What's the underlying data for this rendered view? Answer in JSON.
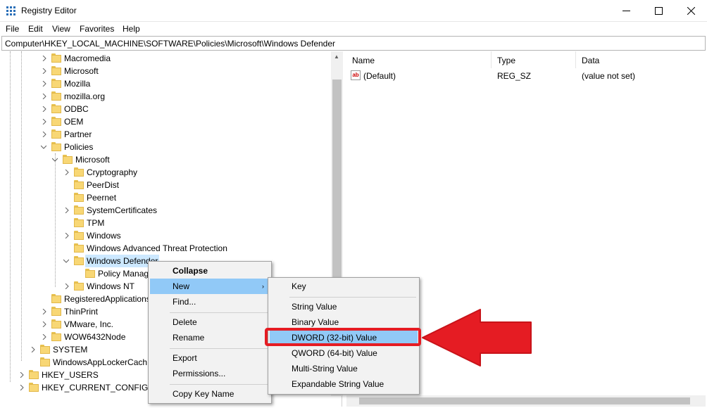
{
  "window": {
    "title": "Registry Editor",
    "accent_color": "#e51c23",
    "highlight_color": "#91c9f7",
    "selection_color": "#cce8ff"
  },
  "menubar": [
    "File",
    "Edit",
    "View",
    "Favorites",
    "Help"
  ],
  "address": "Computer\\HKEY_LOCAL_MACHINE\\SOFTWARE\\Policies\\Microsoft\\Windows Defender",
  "tree": {
    "macromedia": "Macromedia",
    "microsoft": "Microsoft",
    "mozilla": "Mozilla",
    "mozilla_org": "mozilla.org",
    "odbc": "ODBC",
    "oem": "OEM",
    "partner": "Partner",
    "policies": "Policies",
    "pol_microsoft": "Microsoft",
    "cryptography": "Cryptography",
    "peerdist": "PeerDist",
    "peernet": "Peernet",
    "systemcertificates": "SystemCertificates",
    "tpm": "TPM",
    "windows": "Windows",
    "watp": "Windows Advanced Threat Protection",
    "windows_defender": "Windows Defender",
    "policy_manager": "Policy Manag",
    "windows_nt": "Windows NT",
    "registered_apps": "RegisteredApplications",
    "thinprint": "ThinPrint",
    "vmware": "VMware, Inc.",
    "wow6432": "WOW6432Node",
    "system": "SYSTEM",
    "windows_app_locker": "WindowsAppLockerCach",
    "hkey_users": "HKEY_USERS",
    "hkey_current_config": "HKEY_CURRENT_CONFIG"
  },
  "list": {
    "columns": [
      "Name",
      "Type",
      "Data"
    ],
    "rows": [
      {
        "name": "(Default)",
        "type": "REG_SZ",
        "data": "(value not set)",
        "icon": "ab-string-icon"
      }
    ]
  },
  "context_menu": {
    "collapse": "Collapse",
    "new": "New",
    "find": "Find...",
    "delete": "Delete",
    "rename": "Rename",
    "export": "Export",
    "permissions": "Permissions...",
    "copy_key_name": "Copy Key Name"
  },
  "submenu": {
    "key": "Key",
    "string": "String Value",
    "binary": "Binary Value",
    "dword": "DWORD (32-bit) Value",
    "qword": "QWORD (64-bit) Value",
    "multi_string": "Multi-String Value",
    "expandable_string": "Expandable String Value"
  }
}
